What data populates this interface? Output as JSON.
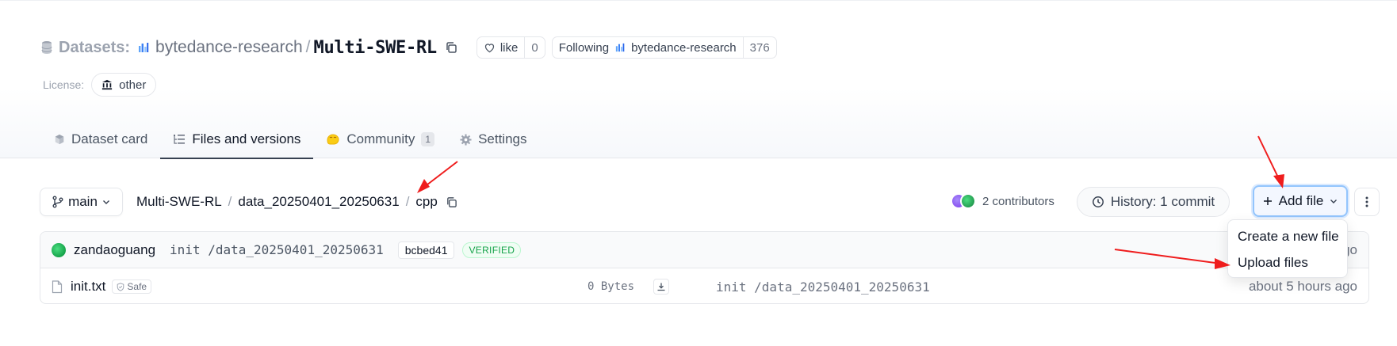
{
  "header": {
    "section_label": "Datasets:",
    "org": "bytedance-research",
    "separator": "/",
    "repo": "Multi-SWE-RL",
    "like_label": "like",
    "like_count": "0",
    "following_label": "Following",
    "following_org": "bytedance-research",
    "followers_count": "376",
    "license_label": "License:",
    "license_value": "other"
  },
  "tabs": [
    {
      "label": "Dataset card"
    },
    {
      "label": "Files and versions"
    },
    {
      "label": "Community",
      "count": "1"
    },
    {
      "label": "Settings"
    }
  ],
  "toolbar": {
    "branch": "main",
    "breadcrumb": [
      "Multi-SWE-RL",
      "data_20250401_20250631",
      "cpp"
    ],
    "breadcrumb_sep": "/",
    "contributors": "2 contributors",
    "history": "History: 1 commit",
    "add_file": "Add file"
  },
  "commit": {
    "author": "zandaoguang",
    "message": "init /data_20250401_20250631",
    "sha": "bcbed41",
    "verified": "VERIFIED",
    "time_visible": "ago"
  },
  "files": [
    {
      "name": "init.txt",
      "safe_label": "Safe",
      "size": "0 Bytes",
      "commit_message": "init /data_20250401_20250631",
      "time": "about 5 hours ago"
    }
  ],
  "dropdown": {
    "items": [
      "Create a new file",
      "Upload files"
    ]
  },
  "colors": {
    "accent_blue": "#93c5fd",
    "verified_green": "#16a34a",
    "annotation_red": "#ef1d1d"
  }
}
